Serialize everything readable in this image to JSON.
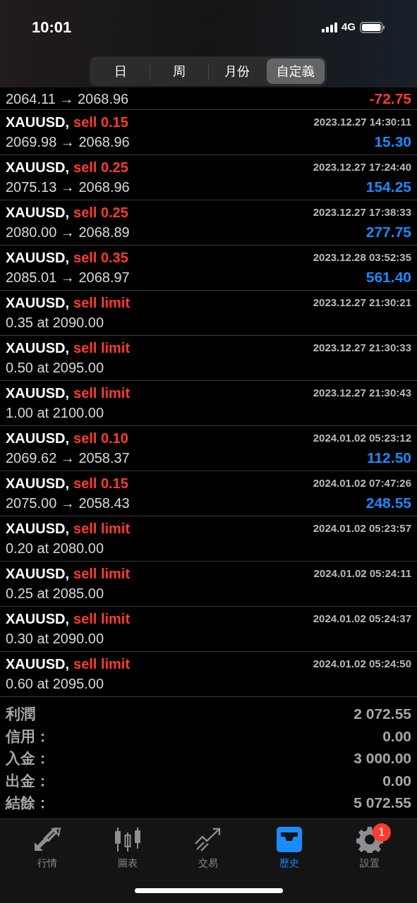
{
  "status_bar": {
    "time": "10:01",
    "network": "4G"
  },
  "period_tabs": [
    {
      "label": "日",
      "selected": false
    },
    {
      "label": "周",
      "selected": false
    },
    {
      "label": "月份",
      "selected": false
    },
    {
      "label": "自定義",
      "selected": true
    }
  ],
  "partial_row": {
    "prices": "2064.11 → 2068.96",
    "profit": "-72.75",
    "loss": true
  },
  "rows": [
    {
      "kind": "deal",
      "symbol": "XAUUSD,",
      "action": "sell 0.15",
      "time": "2023.12.27 14:30:11",
      "prices": "2069.98 → 2068.96",
      "profit": "15.30",
      "loss": false
    },
    {
      "kind": "deal",
      "symbol": "XAUUSD,",
      "action": "sell 0.25",
      "time": "2023.12.27 17:24:40",
      "prices": "2075.13 → 2068.96",
      "profit": "154.25",
      "loss": false
    },
    {
      "kind": "deal",
      "symbol": "XAUUSD,",
      "action": "sell 0.25",
      "time": "2023.12.27 17:38:33",
      "prices": "2080.00 → 2068.89",
      "profit": "277.75",
      "loss": false
    },
    {
      "kind": "deal",
      "symbol": "XAUUSD,",
      "action": "sell 0.35",
      "time": "2023.12.28 03:52:35",
      "prices": "2085.01 → 2068.97",
      "profit": "561.40",
      "loss": false
    },
    {
      "kind": "order",
      "symbol": "XAUUSD,",
      "action": "sell limit",
      "time": "2023.12.27 21:30:21",
      "prices": "0.35 at 2090.00"
    },
    {
      "kind": "order",
      "symbol": "XAUUSD,",
      "action": "sell limit",
      "time": "2023.12.27 21:30:33",
      "prices": "0.50 at 2095.00"
    },
    {
      "kind": "order",
      "symbol": "XAUUSD,",
      "action": "sell limit",
      "time": "2023.12.27 21:30:43",
      "prices": "1.00 at 2100.00"
    },
    {
      "kind": "deal",
      "symbol": "XAUUSD,",
      "action": "sell 0.10",
      "time": "2024.01.02 05:23:12",
      "prices": "2069.62 → 2058.37",
      "profit": "112.50",
      "loss": false
    },
    {
      "kind": "deal",
      "symbol": "XAUUSD,",
      "action": "sell 0.15",
      "time": "2024.01.02 07:47:26",
      "prices": "2075.00 → 2058.43",
      "profit": "248.55",
      "loss": false
    },
    {
      "kind": "order",
      "symbol": "XAUUSD,",
      "action": "sell limit",
      "time": "2024.01.02 05:23:57",
      "prices": "0.20 at 2080.00"
    },
    {
      "kind": "order",
      "symbol": "XAUUSD,",
      "action": "sell limit",
      "time": "2024.01.02 05:24:11",
      "prices": "0.25 at 2085.00"
    },
    {
      "kind": "order",
      "symbol": "XAUUSD,",
      "action": "sell limit",
      "time": "2024.01.02 05:24:37",
      "prices": "0.30 at 2090.00"
    },
    {
      "kind": "order",
      "symbol": "XAUUSD,",
      "action": "sell limit",
      "time": "2024.01.02 05:24:50",
      "prices": "0.60 at 2095.00"
    }
  ],
  "summary": [
    {
      "label": "利潤",
      "value": "2 072.55"
    },
    {
      "label": "信用：",
      "value": "0.00"
    },
    {
      "label": "入金：",
      "value": "3 000.00"
    },
    {
      "label": "出金：",
      "value": "0.00"
    },
    {
      "label": "結餘：",
      "value": "5 072.55"
    }
  ],
  "tab_bar": [
    {
      "kind": "quotes",
      "label": "行情",
      "selected": false
    },
    {
      "kind": "chart",
      "label": "圖表",
      "selected": false
    },
    {
      "kind": "trade",
      "label": "交易",
      "selected": false
    },
    {
      "kind": "history",
      "label": "歷史",
      "selected": true
    },
    {
      "kind": "settings",
      "label": "設置",
      "selected": false,
      "badge": "1"
    }
  ]
}
